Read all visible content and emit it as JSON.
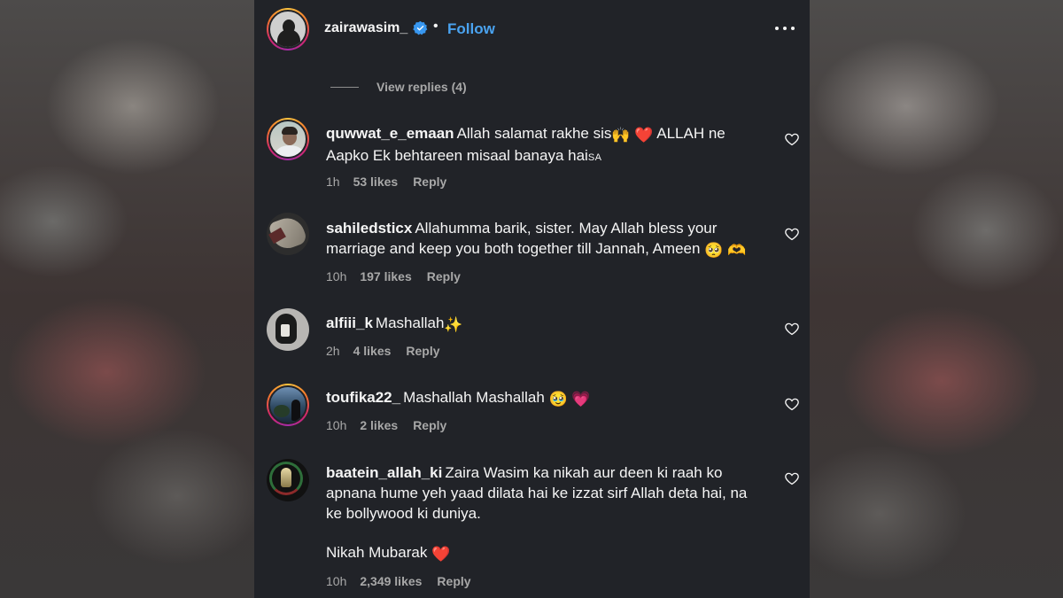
{
  "header": {
    "username": "zairawasim_",
    "separator": "•",
    "follow_label": "Follow",
    "verified": true,
    "more_icon": "more-horizontal-icon"
  },
  "view_replies": {
    "label": "View replies (4)"
  },
  "colors": {
    "panel_bg": "#212328",
    "text": "#f5f5f5",
    "muted": "#a8a8a8",
    "follow": "#4aa3f0",
    "verified": "#3897f0"
  },
  "comments": [
    {
      "username": "quwwat_e_emaan",
      "text_before": "Allah salamat rakhe sis",
      "emoji_1": "🙌",
      "text_mid": " ",
      "emoji_2": "❤️",
      "text_after": " ALLAH ne Aapko Ek behtareen misaal banaya hai",
      "suffix_small": "SA",
      "time": "1h",
      "likes": "53 likes",
      "reply_label": "Reply",
      "story_ring": true
    },
    {
      "username": "sahiledsticx",
      "text_before": "Allahumma barik, sister. May Allah bless your marriage and keep you both together till Jannah, Ameen ",
      "emoji_1": "🥺",
      "text_mid": " ",
      "emoji_2": "🫶",
      "time": "10h",
      "likes": "197 likes",
      "reply_label": "Reply",
      "story_ring": false
    },
    {
      "username": "alfiii_k",
      "text_before": "Mashallah",
      "emoji_1": "✨",
      "time": "2h",
      "likes": "4 likes",
      "reply_label": "Reply",
      "story_ring": false
    },
    {
      "username": "toufika22_",
      "text_before": "Mashallah Mashallah ",
      "emoji_1": "🥹",
      "text_mid": " ",
      "emoji_2": "💗",
      "time": "10h",
      "likes": "2 likes",
      "reply_label": "Reply",
      "story_ring": true
    },
    {
      "username": "baatein_allah_ki",
      "text_before": "Zaira Wasim ka nikah aur deen ki raah ko apnana hume yeh yaad dilata hai ke izzat sirf Allah deta hai, na ke bollywood ki duniya.",
      "extra_before": "Nikah Mubarak ",
      "extra_emoji": "❤️",
      "time": "10h",
      "likes": "2,349 likes",
      "reply_label": "Reply",
      "story_ring": false
    }
  ]
}
